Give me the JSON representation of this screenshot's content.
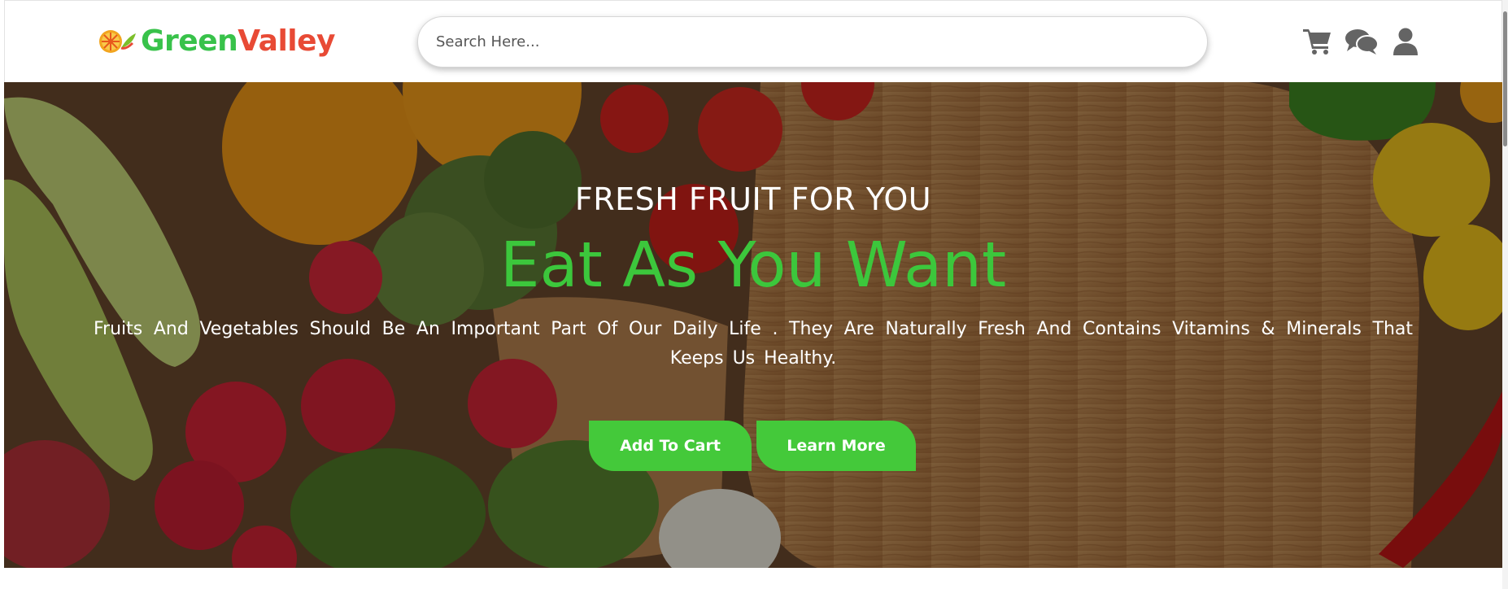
{
  "brand": {
    "name_part1": "Green",
    "name_part2": "Valley",
    "logo_icon": "fruit-slices-icon",
    "colors": {
      "green": "#38c24a",
      "red": "#e84a35"
    }
  },
  "search": {
    "placeholder": "Search Here..."
  },
  "header_icons": [
    {
      "name": "cart-icon"
    },
    {
      "name": "chat-icon"
    },
    {
      "name": "user-icon"
    }
  ],
  "hero": {
    "kicker": "FRESH FRUIT FOR YOU",
    "title": "Eat As You Want",
    "description": "Fruits And Vegetables Should Be An Important Part Of Our Daily Life . They Are Naturally Fresh And Contains Vitamins & Minerals That Keeps Us Healthy.",
    "background": "fruits-and-vegetables-on-wooden-board",
    "accent_color": "#3cc73c",
    "buttons": {
      "add_to_cart": "Add To Cart",
      "learn_more": "Learn More"
    }
  }
}
